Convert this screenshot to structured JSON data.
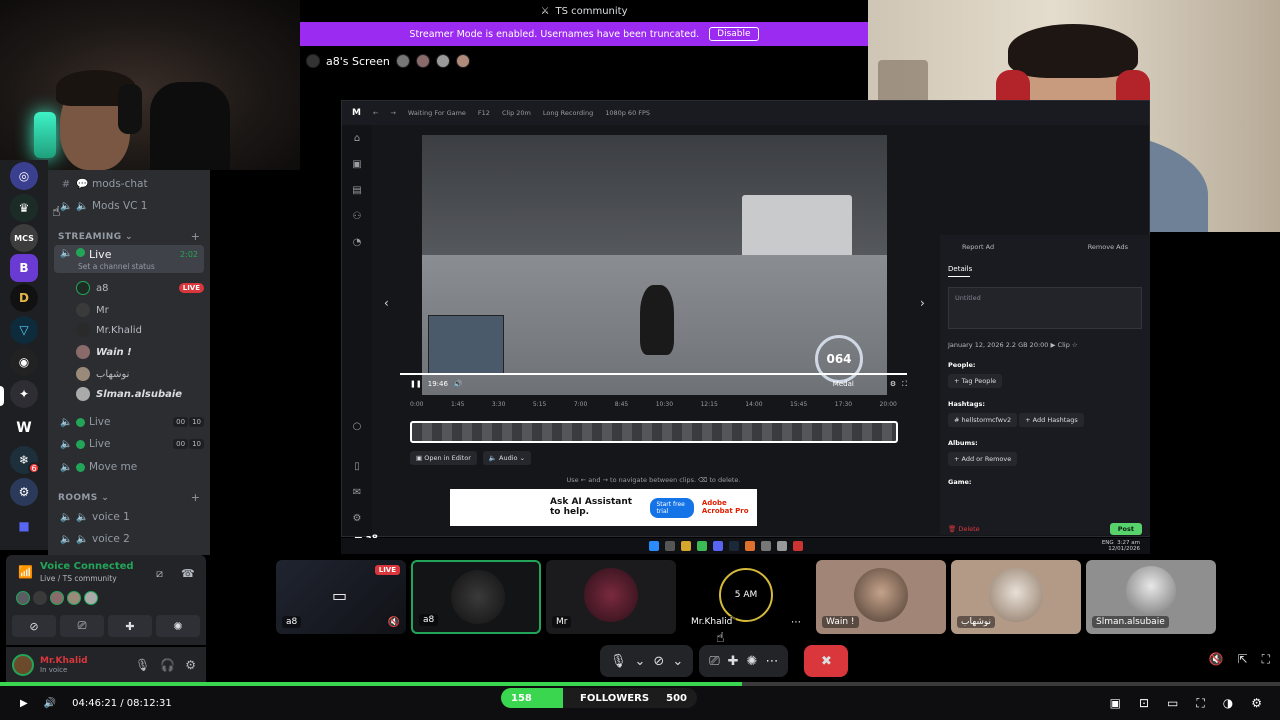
{
  "window": {
    "server_title": "TS community",
    "streamer_banner": "Streamer Mode is enabled. Usernames have been truncated.",
    "disable_label": "Disable",
    "screen_title": "a8's Screen"
  },
  "channels": {
    "mods_chat": "mods-chat",
    "mods_vc": "Mods VC 1",
    "streaming_category": "STREAMING",
    "live_channel": "Live",
    "live_status": "Set a channel status",
    "live_time": "2:02",
    "users": [
      {
        "name": "a8",
        "live": "LIVE"
      },
      {
        "name": "Mr"
      },
      {
        "name": "Mr.Khalid"
      },
      {
        "name": "Wain !"
      },
      {
        "name": "نوشهاب"
      },
      {
        "name": "Slman.alsubaie"
      }
    ],
    "live2": "Live",
    "live2_counts": [
      "00",
      "10"
    ],
    "live3": "Live",
    "live3_counts": [
      "00",
      "10"
    ],
    "move_me": "Move me",
    "rooms_category": "ROOMS",
    "voice1": "voice 1",
    "voice2": "voice 2"
  },
  "voice_panel": {
    "title": "Voice Connected",
    "sub": "Live / TS community"
  },
  "userbar": {
    "name": "Mr.Khalid",
    "status": "In voice"
  },
  "medal": {
    "status": "Waiting For Game",
    "hotkey": "F12",
    "clip_len": "Clip 20m",
    "rec_mode": "Long Recording",
    "quality": "1080p 60 FPS",
    "time_now": "19:46",
    "brand": "Medal",
    "speed": "064",
    "ticks": [
      "0:00",
      "1:45",
      "3:30",
      "5:15",
      "7:00",
      "8:45",
      "10:30",
      "12:15",
      "14:00",
      "15:45",
      "17:30",
      "20:00"
    ],
    "open_editor": "Open in Editor",
    "audio": "Audio",
    "nav_hint": "Use ← and → to navigate between clips. ⌫ to delete.",
    "ad": {
      "headline": "Ask AI Assistant to help.",
      "cta": "Start free trial",
      "brand": "Adobe Acrobat Pro"
    },
    "details": {
      "report_ad": "Report Ad",
      "remove_ads": "Remove Ads",
      "tab": "Details",
      "title_placeholder": "Untitled",
      "meta": "January 12, 2026   2.2 GB   20:00   ▶ Clip   ☆",
      "people_label": "People:",
      "tag_people": "+ Tag People",
      "hashtags_label": "Hashtags:",
      "hashtag": "# hellstormcfwv2",
      "add_hashtags": "+ Add Hashtags",
      "albums_label": "Albums:",
      "add_remove": "+ Add or Remove",
      "game_label": "Game:",
      "delete": "🗑 Delete",
      "post": "Post"
    },
    "tray": "ENG",
    "tray_time": "3:27 am",
    "tray_date": "12/01/2026",
    "screen_label": "a8"
  },
  "tiles": [
    {
      "name": "a8",
      "live": "LIVE"
    },
    {
      "name": "a8"
    },
    {
      "name": "Mr"
    },
    {
      "name": "Mr.Khalid",
      "clock": "5 AM"
    },
    {
      "name": "Wain !"
    },
    {
      "name": "نوشهاب"
    },
    {
      "name": "Slman.alsubaie"
    }
  ],
  "player": {
    "time": "04:46:21 / 08:12:31",
    "progress_fraction": 0.58,
    "followers_now": "158",
    "followers_label": "FOLLOWERS",
    "followers_goal": "500",
    "followers_fraction": 0.316
  },
  "colors": {
    "accent_green": "#23a559",
    "streamer_purple": "#9b2bf0",
    "danger_red": "#da373c"
  }
}
